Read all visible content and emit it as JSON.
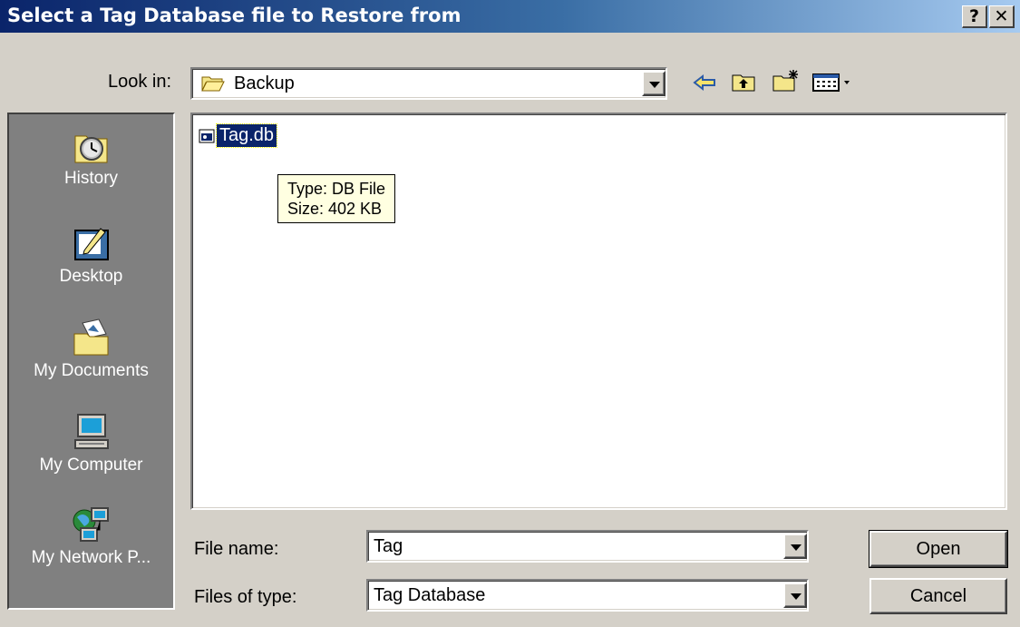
{
  "window": {
    "title": "Select a Tag Database file to Restore from",
    "help_label": "?",
    "close_label": "✕"
  },
  "toolbar": {
    "look_in_label": "Look in:",
    "look_in_value": "Backup",
    "icons": [
      "back-icon",
      "up-folder-icon",
      "new-folder-icon",
      "view-menu-icon"
    ]
  },
  "places": [
    {
      "label": "History",
      "icon": "history-icon"
    },
    {
      "label": "Desktop",
      "icon": "desktop-icon"
    },
    {
      "label": "My Documents",
      "icon": "my-documents-icon"
    },
    {
      "label": "My Computer",
      "icon": "my-computer-icon"
    },
    {
      "label": "My Network P...",
      "icon": "network-places-icon"
    }
  ],
  "files": [
    {
      "name": "Tag.db",
      "selected": true
    }
  ],
  "tooltip": {
    "type": "Type: DB File",
    "size": "Size: 402 KB"
  },
  "form": {
    "file_name_label": "File name:",
    "file_name_value": "Tag",
    "file_type_label": "Files of type:",
    "file_type_value": "Tag Database"
  },
  "buttons": {
    "open": "Open",
    "cancel": "Cancel"
  },
  "colors": {
    "title_start": "#0a246a",
    "title_end": "#a6caf0",
    "face": "#d4d0c8",
    "selection": "#0a246a",
    "tooltip_bg": "#ffffe1"
  }
}
